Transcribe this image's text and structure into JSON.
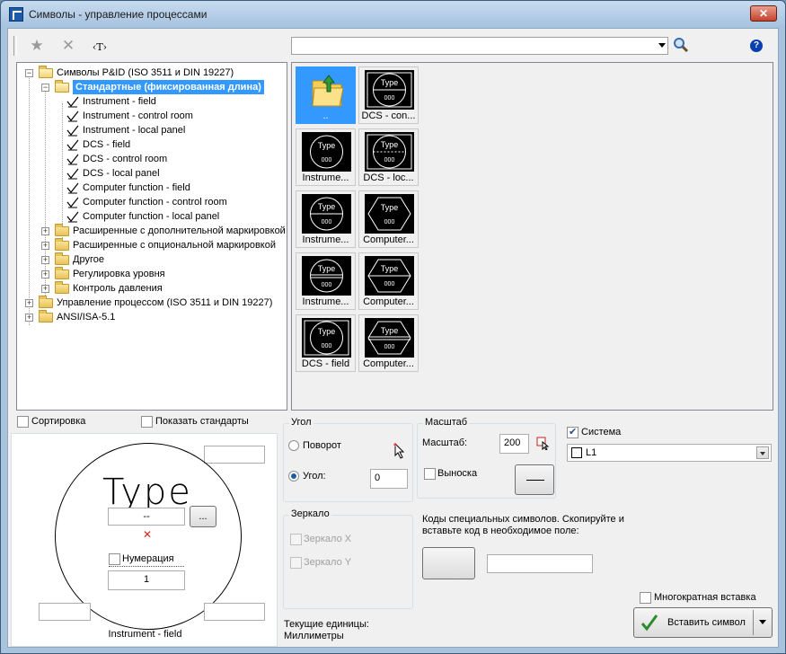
{
  "window": {
    "title": "Символы - управление процессами",
    "close_label": "✕"
  },
  "toolbar": {
    "text_tool_label": "‹T›",
    "search_value": ""
  },
  "tree": {
    "root_label": "Символы P&ID (ISO 3511 и DIN 19227)",
    "selected_label": "Стандартные (фиксированная длина)",
    "leaves": [
      "Instrument - field",
      "Instrument - control room",
      "Instrument - local panel",
      "DCS - field",
      "DCS - control room",
      "DCS - local panel",
      "Computer function - field",
      "Computer function - control room",
      "Computer function - local panel"
    ],
    "subfolders": [
      "Расширенные с дополнительной маркировкой",
      "Расширенные с опциональной маркировкой",
      "Другое",
      "Регулировка уровня",
      "Контроль давления"
    ],
    "top_folders": [
      "Управление процессом (ISO 3511 и DIN 19227)",
      "ANSI/ISA-5.1"
    ]
  },
  "gallery": {
    "symbol_text": "Type",
    "symbol_number": "000",
    "items": [
      {
        "label": "..",
        "kind": "folder"
      },
      {
        "label": "DCS - con...",
        "kind": "dcs"
      },
      {
        "label": "Instrume...",
        "kind": "circle"
      },
      {
        "label": "DCS - loc...",
        "kind": "dcs"
      },
      {
        "label": "Instrume...",
        "kind": "circle-line"
      },
      {
        "label": "Computer...",
        "kind": "hex"
      },
      {
        "label": "Instrume...",
        "kind": "circle-double"
      },
      {
        "label": "Computer...",
        "kind": "hex-line"
      },
      {
        "label": "DCS - field",
        "kind": "dcs-circle"
      },
      {
        "label": "Computer...",
        "kind": "hex-double"
      }
    ]
  },
  "options": {
    "sort_label": "Сортировка",
    "show_standards_label": "Показать стандарты"
  },
  "preview": {
    "type_text": "Type",
    "label_value": "--",
    "browse_label": "...",
    "numbering_label": "Нумерация",
    "number_value": "1",
    "caption": "Instrument - field"
  },
  "angle": {
    "group_title": "Угол",
    "rotation_label": "Поворот",
    "angle_label": "Угол:",
    "angle_value": "0"
  },
  "scale": {
    "group_title": "Масштаб",
    "scale_label": "Масштаб:",
    "scale_value": "200",
    "leader_label": "Выноска"
  },
  "system": {
    "label": "Система",
    "layer_value": "L1"
  },
  "mirror": {
    "group_title": "Зеркало",
    "x_label": "Зеркало X",
    "y_label": "Зеркало Y"
  },
  "special_codes": {
    "text": "Коды специальных символов. Скопируйте и вставьте код в необходимое поле:"
  },
  "units": {
    "label": "Текущие единицы:",
    "value": "Миллиметры"
  },
  "multi_insert_label": "Многократная вставка",
  "insert_button_label": "Вставить символ"
}
